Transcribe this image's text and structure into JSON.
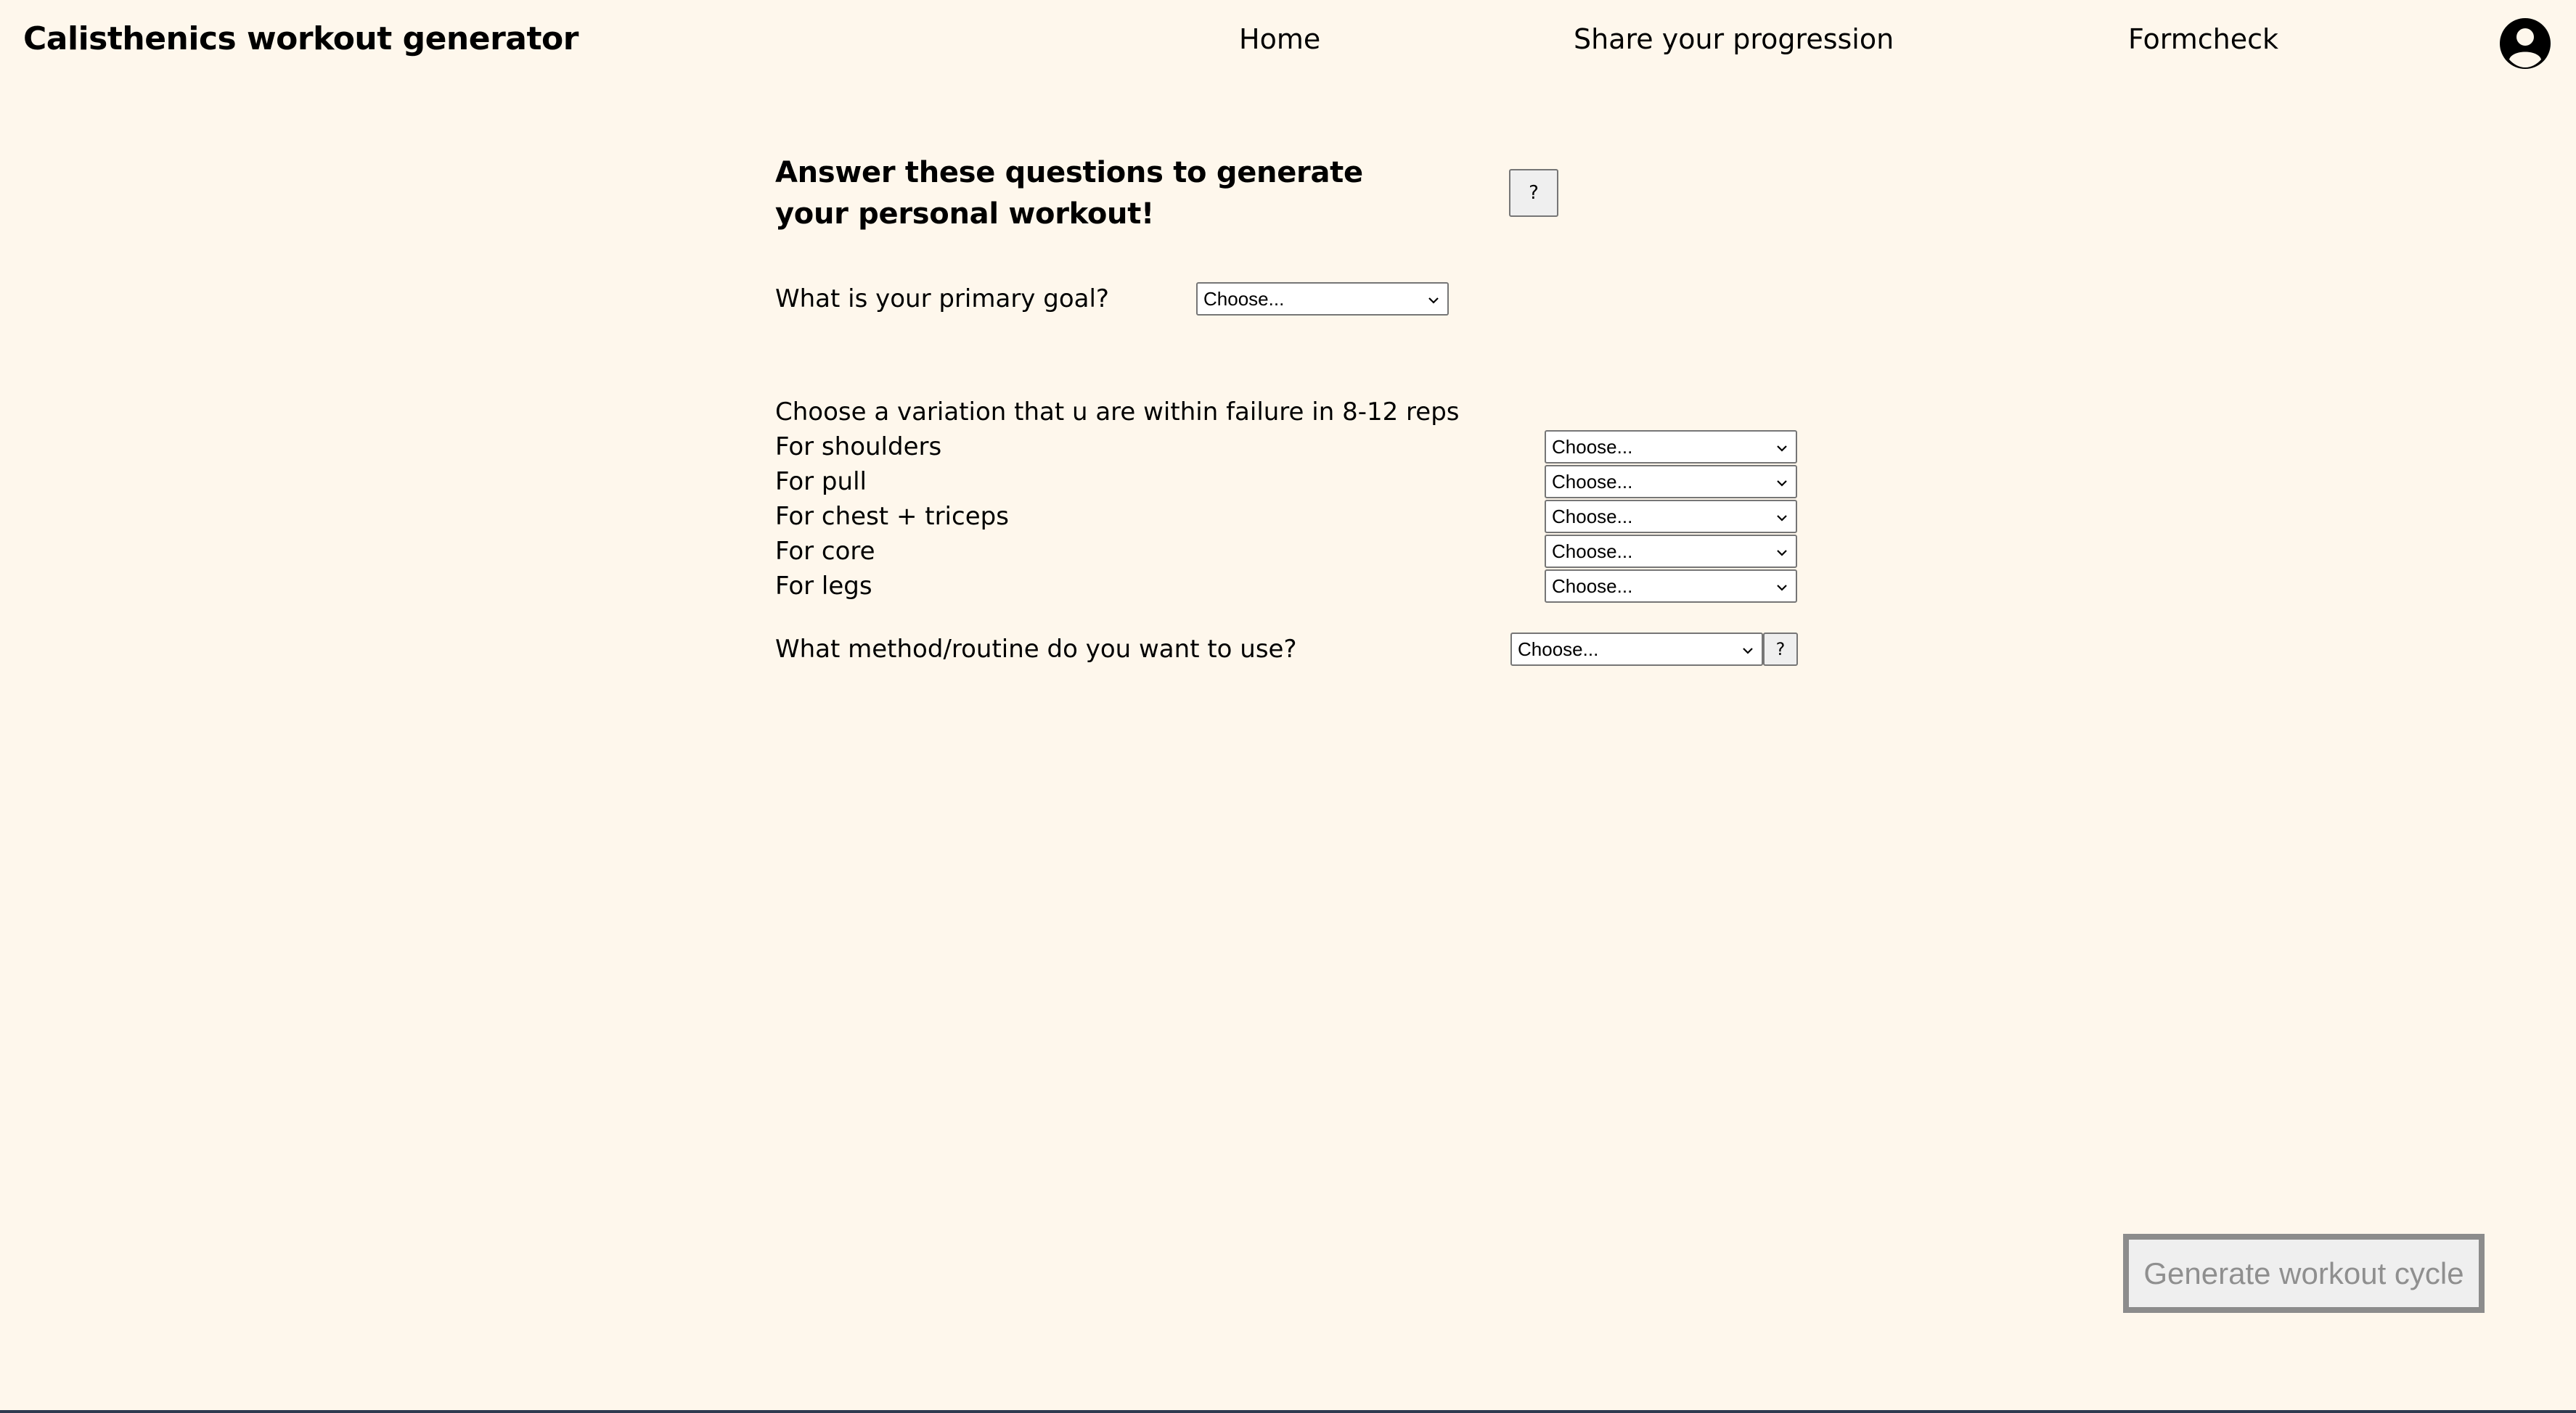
{
  "header": {
    "app_title": "Calisthenics workout generator",
    "nav": {
      "home": "Home",
      "share": "Share your progression",
      "formcheck": "Formcheck"
    },
    "avatar_icon": "user-circle-icon"
  },
  "form": {
    "heading": "Answer these questions to generate your personal workout!",
    "help_label": "?",
    "goal": {
      "label": "What is your primary goal?",
      "selected": "Choose..."
    },
    "variation": {
      "label": "Choose a variation that u are within failure in 8-12 reps",
      "items": [
        {
          "label": "For shoulders",
          "selected": "Choose..."
        },
        {
          "label": "For pull",
          "selected": "Choose..."
        },
        {
          "label": "For chest + triceps",
          "selected": "Choose..."
        },
        {
          "label": "For core",
          "selected": "Choose..."
        },
        {
          "label": "For legs",
          "selected": "Choose..."
        }
      ]
    },
    "method": {
      "label": "What method/routine do you want to use?",
      "selected": "Choose...",
      "help_label": "?"
    },
    "generate_label": "Generate workout cycle"
  },
  "colors": {
    "background": "#fef7ec",
    "text": "#000000",
    "disabled_text": "#8f8f8f",
    "disabled_border": "#8c8c8c"
  }
}
